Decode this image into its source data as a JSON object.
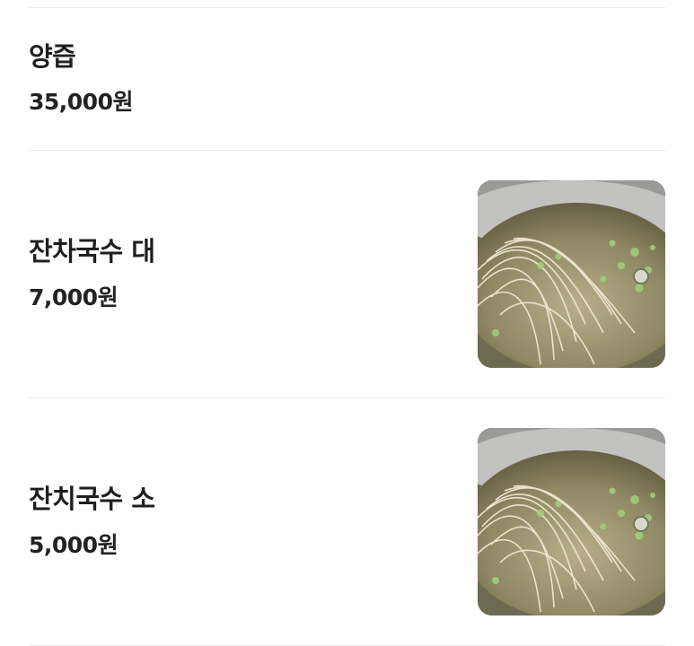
{
  "menu": {
    "items": [
      {
        "name": "양즙",
        "price": "35,000원",
        "has_image": false
      },
      {
        "name": "잔차국수 대",
        "price": "7,000원",
        "has_image": true,
        "image": "noodle-soup-photo"
      },
      {
        "name": "잔치국수 소",
        "price": "5,000원",
        "has_image": true,
        "image": "noodle-soup-photo"
      }
    ]
  }
}
